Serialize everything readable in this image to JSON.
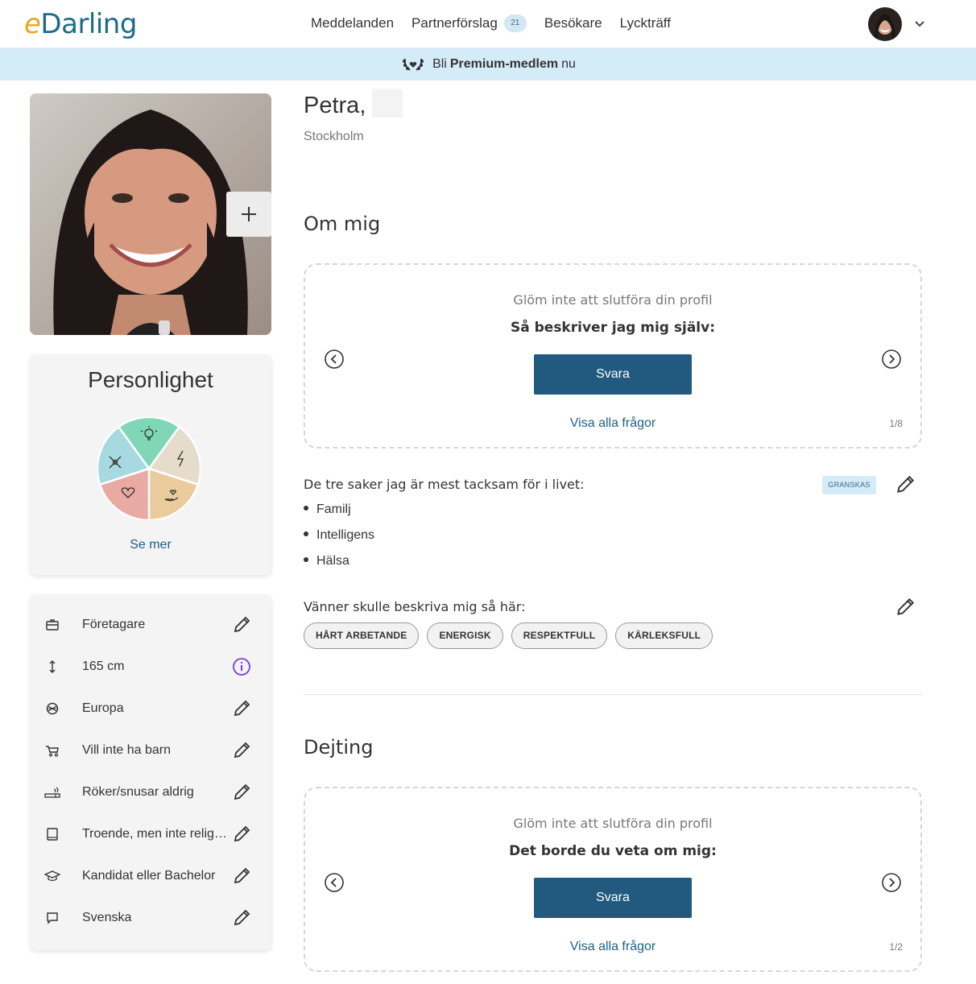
{
  "header": {
    "logo_e": "e",
    "logo_rest": "Darling",
    "nav": [
      {
        "label": "Meddelanden"
      },
      {
        "label": "Partnerförslag",
        "badge": "21"
      },
      {
        "label": "Besökare"
      },
      {
        "label": "Lyckträff"
      }
    ]
  },
  "premium": {
    "prefix": "Bli",
    "bold": "Premium-medlem",
    "suffix": "nu"
  },
  "profile": {
    "name": "Petra,",
    "city": "Stockholm"
  },
  "personality": {
    "title": "Personlighet",
    "link": "Se mer",
    "colors": {
      "green": "#7fd7b8",
      "beige": "#e6dccb",
      "orange": "#eacb9c",
      "pink": "#e8aaa3",
      "blue": "#a6d9e0"
    }
  },
  "facts": [
    {
      "icon": "briefcase-icon",
      "text": "Företagare",
      "action": "edit"
    },
    {
      "icon": "height-icon",
      "text": "165 cm",
      "action": "info"
    },
    {
      "icon": "globe-icon",
      "text": "Europa",
      "action": "edit"
    },
    {
      "icon": "stroller-icon",
      "text": "Vill inte ha barn",
      "action": "edit"
    },
    {
      "icon": "cigarette-icon",
      "text": "Röker/snusar aldrig",
      "action": "edit"
    },
    {
      "icon": "book-icon",
      "text": "Troende, men inte religiös",
      "action": "edit"
    },
    {
      "icon": "graduation-cap-icon",
      "text": "Kandidat eller Bachelor",
      "action": "edit"
    },
    {
      "icon": "speech-bubble-icon",
      "text": "Svenska",
      "action": "edit"
    }
  ],
  "om_mig": {
    "heading": "Om mig",
    "box": {
      "hint": "Glöm inte att slutföra din profil",
      "question": "Så beskriver jag mig själv:",
      "button": "Svara",
      "link": "Visa alla frågor",
      "pager": "1/8"
    },
    "grateful": {
      "title": "De tre saker jag är mest tacksam för i livet:",
      "status": "GRANSKAS",
      "items": [
        "Familj",
        "Intelligens",
        "Hälsa"
      ]
    },
    "friends": {
      "title": "Vänner skulle beskriva mig så här:",
      "tags": [
        "HÅRT ARBETANDE",
        "ENERGISK",
        "RESPEKTFULL",
        "KÄRLEKSFULL"
      ]
    }
  },
  "dejting": {
    "heading": "Dejting",
    "box": {
      "hint": "Glöm inte att slutföra din profil",
      "question": "Det borde du veta om mig:",
      "button": "Svara",
      "link": "Visa alla frågor",
      "pager": "1/2"
    }
  }
}
